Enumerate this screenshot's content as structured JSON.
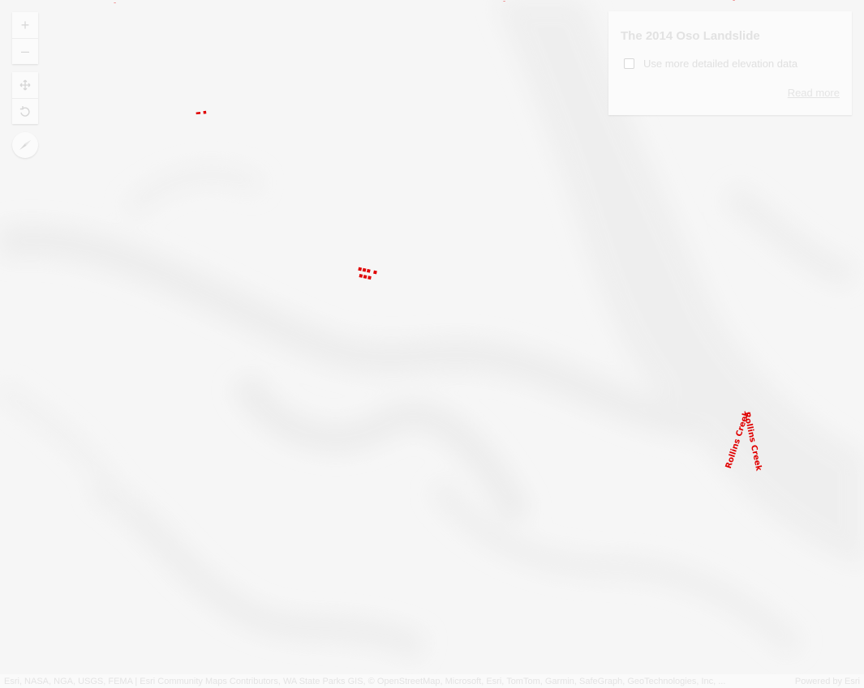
{
  "map": {
    "controls": {
      "zoom_in": "+",
      "zoom_out": "–",
      "pan_icon": "pan-icon",
      "rotate_icon": "rotate-icon",
      "compass_icon": "compass-icon"
    },
    "labels": [
      {
        "text": "Rollins Creek",
        "color": "#e00000"
      }
    ]
  },
  "panel": {
    "title": "The 2014 Oso Landslide",
    "checkbox_label": "Use more detailed elevation data",
    "checkbox_checked": false,
    "read_more": "Read more"
  },
  "attribution": {
    "text": "Esri, NASA, NGA, USGS, FEMA | Esri Community Maps Contributors, WA State Parks GIS, © OpenStreetMap, Microsoft, Esri, TomTom, Garmin, SafeGraph, GeoTechnologies, Inc, ...",
    "powered_by": "Powered by Esri"
  }
}
